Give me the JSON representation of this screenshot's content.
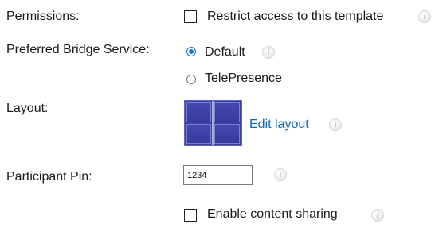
{
  "permissions": {
    "label": "Permissions:",
    "checkbox_label": "Restrict access to this template",
    "checked": false
  },
  "bridge": {
    "label": "Preferred Bridge Service:",
    "options": [
      {
        "label": "Default",
        "selected": true
      },
      {
        "label": "TelePresence",
        "selected": false
      }
    ]
  },
  "layout": {
    "label": "Layout:",
    "edit_link": "Edit layout"
  },
  "pin": {
    "label": "Participant Pin:",
    "value": "1234"
  },
  "content_sharing": {
    "checkbox_label": "Enable content sharing",
    "checked": false
  },
  "icons": {
    "info": "info-icon",
    "info_glyph": "i"
  },
  "colors": {
    "link": "#1167b1",
    "radio_selected": "#1b73d4",
    "layout_thumb": "#3c3fa2"
  }
}
